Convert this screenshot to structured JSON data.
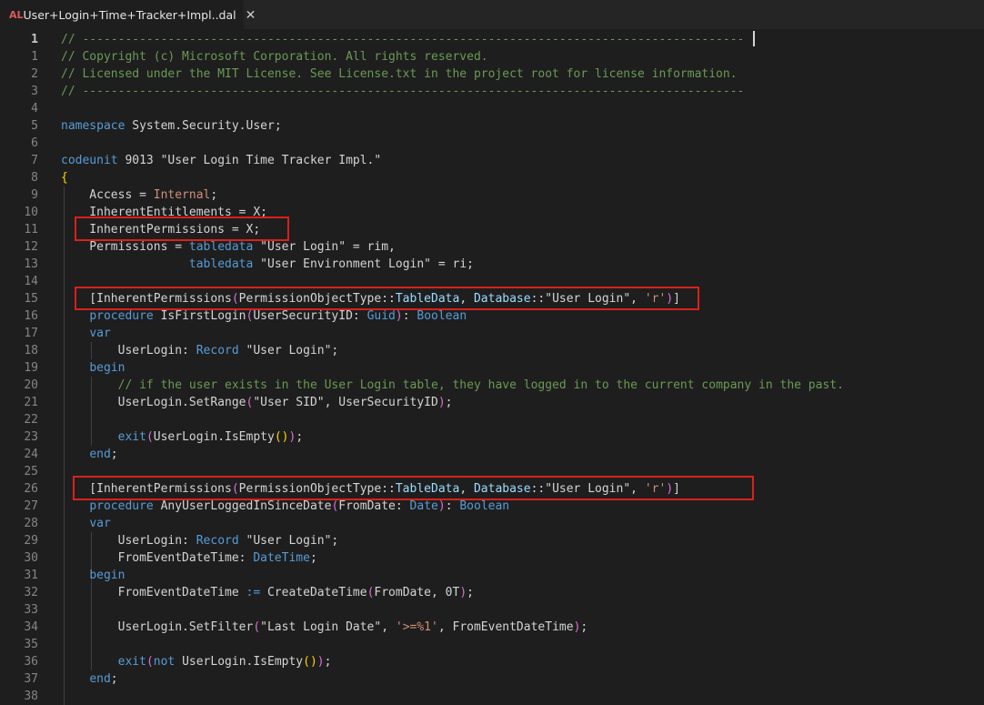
{
  "tab": {
    "icon_text": "AL",
    "title": "User+Login+Time+Tracker+Impl..dal",
    "close_glyph": "✕"
  },
  "lines": [
    {
      "num": "1",
      "active": true,
      "tokens": [
        {
          "t": "// ---------------------------------------------------------------------------------------------",
          "c": "comment"
        }
      ]
    },
    {
      "num": "1",
      "tokens": [
        {
          "t": "// Copyright (c) Microsoft Corporation. All rights reserved.",
          "c": "comment"
        }
      ]
    },
    {
      "num": "2",
      "tokens": [
        {
          "t": "// Licensed under the MIT License. See License.txt in the project root for license information.",
          "c": "comment"
        }
      ]
    },
    {
      "num": "3",
      "tokens": [
        {
          "t": "// ---------------------------------------------------------------------------------------------",
          "c": "comment"
        }
      ]
    },
    {
      "num": "4",
      "tokens": []
    },
    {
      "num": "5",
      "tokens": [
        {
          "t": "namespace",
          "c": "kw"
        },
        {
          "t": " System.Security.User;",
          "c": "txt"
        }
      ]
    },
    {
      "num": "6",
      "tokens": []
    },
    {
      "num": "7",
      "tokens": [
        {
          "t": "codeunit",
          "c": "kw"
        },
        {
          "t": " 9013 \"User Login Time Tracker Impl.\"",
          "c": "txt"
        }
      ]
    },
    {
      "num": "8",
      "tokens": [
        {
          "t": "{",
          "c": "brace"
        }
      ]
    },
    {
      "num": "9",
      "tokens": [
        {
          "t": "    Access = ",
          "c": "txt"
        },
        {
          "t": "Internal",
          "c": "str"
        },
        {
          "t": ";",
          "c": "txt"
        }
      ]
    },
    {
      "num": "10",
      "tokens": [
        {
          "t": "    InherentEntitlements = X;",
          "c": "txt"
        }
      ]
    },
    {
      "num": "11",
      "tokens": [
        {
          "t": "    InherentPermissions = X;",
          "c": "txt"
        }
      ]
    },
    {
      "num": "12",
      "tokens": [
        {
          "t": "    Permissions = ",
          "c": "txt"
        },
        {
          "t": "tabledata",
          "c": "kw"
        },
        {
          "t": " \"User Login\" = rim,",
          "c": "txt"
        }
      ]
    },
    {
      "num": "13",
      "tokens": [
        {
          "t": "                  ",
          "c": "txt"
        },
        {
          "t": "tabledata",
          "c": "kw"
        },
        {
          "t": " \"User Environment Login\" = ri;",
          "c": "txt"
        }
      ]
    },
    {
      "num": "14",
      "tokens": []
    },
    {
      "num": "15",
      "tokens": [
        {
          "t": "    [InherentPermissions",
          "c": "txt"
        },
        {
          "t": "(",
          "c": "paren"
        },
        {
          "t": "PermissionObjectType::",
          "c": "txt"
        },
        {
          "t": "TableData",
          "c": "var"
        },
        {
          "t": ", ",
          "c": "txt"
        },
        {
          "t": "Database",
          "c": "var"
        },
        {
          "t": "::\"User Login\", ",
          "c": "txt"
        },
        {
          "t": "'r'",
          "c": "str"
        },
        {
          "t": ")",
          "c": "paren"
        },
        {
          "t": "]",
          "c": "txt"
        }
      ]
    },
    {
      "num": "16",
      "tokens": [
        {
          "t": "    ",
          "c": "txt"
        },
        {
          "t": "procedure",
          "c": "kw"
        },
        {
          "t": " IsFirstLogin",
          "c": "txt"
        },
        {
          "t": "(",
          "c": "paren"
        },
        {
          "t": "UserSecurityID: ",
          "c": "txt"
        },
        {
          "t": "Guid",
          "c": "kw"
        },
        {
          "t": ")",
          "c": "paren"
        },
        {
          "t": ": ",
          "c": "txt"
        },
        {
          "t": "Boolean",
          "c": "kw"
        }
      ]
    },
    {
      "num": "17",
      "tokens": [
        {
          "t": "    ",
          "c": "txt"
        },
        {
          "t": "var",
          "c": "kw"
        }
      ]
    },
    {
      "num": "18",
      "tokens": [
        {
          "t": "        UserLogin: ",
          "c": "txt"
        },
        {
          "t": "Record",
          "c": "kw"
        },
        {
          "t": " \"User Login\";",
          "c": "txt"
        }
      ]
    },
    {
      "num": "19",
      "tokens": [
        {
          "t": "    ",
          "c": "txt"
        },
        {
          "t": "begin",
          "c": "kw"
        }
      ]
    },
    {
      "num": "20",
      "tokens": [
        {
          "t": "        ",
          "c": "txt"
        },
        {
          "t": "// if the user exists in the User Login table, they have logged in to the current company in the past.",
          "c": "comment"
        }
      ]
    },
    {
      "num": "21",
      "tokens": [
        {
          "t": "        UserLogin.SetRange",
          "c": "txt"
        },
        {
          "t": "(",
          "c": "paren"
        },
        {
          "t": "\"User SID\", UserSecurityID",
          "c": "txt"
        },
        {
          "t": ")",
          "c": "paren"
        },
        {
          "t": ";",
          "c": "txt"
        }
      ]
    },
    {
      "num": "22",
      "tokens": []
    },
    {
      "num": "23",
      "tokens": [
        {
          "t": "        ",
          "c": "txt"
        },
        {
          "t": "exit",
          "c": "kw"
        },
        {
          "t": "(",
          "c": "paren"
        },
        {
          "t": "UserLogin.IsEmpty",
          "c": "txt"
        },
        {
          "t": "()",
          "c": "brace"
        },
        {
          "t": ")",
          "c": "paren"
        },
        {
          "t": ";",
          "c": "txt"
        }
      ]
    },
    {
      "num": "24",
      "tokens": [
        {
          "t": "    ",
          "c": "txt"
        },
        {
          "t": "end",
          "c": "kw"
        },
        {
          "t": ";",
          "c": "txt"
        }
      ]
    },
    {
      "num": "25",
      "tokens": []
    },
    {
      "num": "26",
      "tokens": [
        {
          "t": "    [InherentPermissions",
          "c": "txt"
        },
        {
          "t": "(",
          "c": "paren"
        },
        {
          "t": "PermissionObjectType::",
          "c": "txt"
        },
        {
          "t": "TableData",
          "c": "var"
        },
        {
          "t": ", ",
          "c": "txt"
        },
        {
          "t": "Database",
          "c": "var"
        },
        {
          "t": "::\"User Login\", ",
          "c": "txt"
        },
        {
          "t": "'r'",
          "c": "str"
        },
        {
          "t": ")",
          "c": "paren"
        },
        {
          "t": "]",
          "c": "txt"
        }
      ]
    },
    {
      "num": "27",
      "tokens": [
        {
          "t": "    ",
          "c": "txt"
        },
        {
          "t": "procedure",
          "c": "kw"
        },
        {
          "t": " AnyUserLoggedInSinceDate",
          "c": "txt"
        },
        {
          "t": "(",
          "c": "paren"
        },
        {
          "t": "FromDate: ",
          "c": "txt"
        },
        {
          "t": "Date",
          "c": "kw"
        },
        {
          "t": ")",
          "c": "paren"
        },
        {
          "t": ": ",
          "c": "txt"
        },
        {
          "t": "Boolean",
          "c": "kw"
        }
      ]
    },
    {
      "num": "28",
      "tokens": [
        {
          "t": "    ",
          "c": "txt"
        },
        {
          "t": "var",
          "c": "kw"
        }
      ]
    },
    {
      "num": "29",
      "tokens": [
        {
          "t": "        UserLogin: ",
          "c": "txt"
        },
        {
          "t": "Record",
          "c": "kw"
        },
        {
          "t": " \"User Login\";",
          "c": "txt"
        }
      ]
    },
    {
      "num": "30",
      "tokens": [
        {
          "t": "        FromEventDateTime: ",
          "c": "txt"
        },
        {
          "t": "DateTime",
          "c": "kw"
        },
        {
          "t": ";",
          "c": "txt"
        }
      ]
    },
    {
      "num": "31",
      "tokens": [
        {
          "t": "    ",
          "c": "txt"
        },
        {
          "t": "begin",
          "c": "kw"
        }
      ]
    },
    {
      "num": "32",
      "tokens": [
        {
          "t": "        FromEventDateTime ",
          "c": "txt"
        },
        {
          "t": ":=",
          "c": "kw"
        },
        {
          "t": " CreateDateTime",
          "c": "txt"
        },
        {
          "t": "(",
          "c": "paren"
        },
        {
          "t": "FromDate, 0T",
          "c": "txt"
        },
        {
          "t": ")",
          "c": "paren"
        },
        {
          "t": ";",
          "c": "txt"
        }
      ]
    },
    {
      "num": "33",
      "tokens": []
    },
    {
      "num": "34",
      "tokens": [
        {
          "t": "        UserLogin.SetFilter",
          "c": "txt"
        },
        {
          "t": "(",
          "c": "paren"
        },
        {
          "t": "\"Last Login Date\", ",
          "c": "txt"
        },
        {
          "t": "'>=%1'",
          "c": "str"
        },
        {
          "t": ", FromEventDateTime",
          "c": "txt"
        },
        {
          "t": ")",
          "c": "paren"
        },
        {
          "t": ";",
          "c": "txt"
        }
      ]
    },
    {
      "num": "35",
      "tokens": []
    },
    {
      "num": "36",
      "tokens": [
        {
          "t": "        ",
          "c": "txt"
        },
        {
          "t": "exit",
          "c": "kw"
        },
        {
          "t": "(",
          "c": "paren"
        },
        {
          "t": "not",
          "c": "kw"
        },
        {
          "t": " UserLogin.IsEmpty",
          "c": "txt"
        },
        {
          "t": "()",
          "c": "brace"
        },
        {
          "t": ")",
          "c": "paren"
        },
        {
          "t": ";",
          "c": "txt"
        }
      ]
    },
    {
      "num": "37",
      "tokens": [
        {
          "t": "    ",
          "c": "txt"
        },
        {
          "t": "end",
          "c": "kw"
        },
        {
          "t": ";",
          "c": "txt"
        }
      ]
    },
    {
      "num": "38",
      "tokens": []
    }
  ],
  "colors": {
    "comment": "#6a9955",
    "kw": "#569cd6",
    "str": "#ce9178",
    "var": "#9cdcfe",
    "txt": "#d4d4d4",
    "brace": "#ffd700",
    "paren": "#da70d6",
    "highlight_box": "#d9211c"
  }
}
